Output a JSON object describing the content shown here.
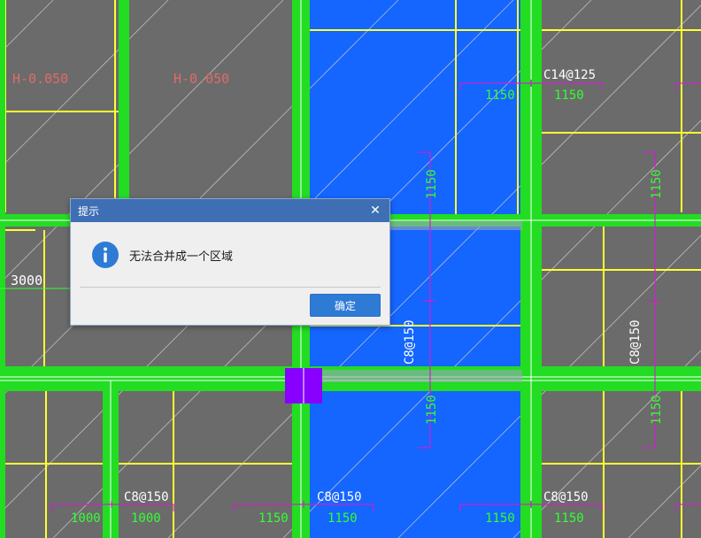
{
  "canvas": {
    "labels": {
      "elev_left": "H-0.050",
      "elev_mid": "H-0.050",
      "dim_3000": "3000",
      "c14_top": "C14@125",
      "dim_1150_top_a": "1150",
      "dim_1150_top_b": "1150",
      "dim_1150_v_top_mid": "1150",
      "dim_1150_v_top_right": "1150",
      "c8_v_mid": "C8@150",
      "c8_v_right": "C8@150",
      "dim_1150_v_bot_mid": "1150",
      "dim_1150_v_bot_right": "1150",
      "c8_bot_left": "C8@150",
      "c8_bot_mid": "C8@150",
      "c8_bot_right": "C8@150",
      "dim_1000_a": "1000",
      "dim_1000_b": "1000",
      "dim_1150_bot_a": "1150",
      "dim_1150_bot_b": "1150",
      "dim_1150_bot_c": "1150",
      "dim_1150_bot_d": "1150"
    },
    "colors": {
      "background": "#6b6b6b",
      "slab_fill": "#1565ff",
      "beam_green": "#22dd22",
      "grid_yellow": "#ffff33",
      "dim_magenta": "#cc22cc",
      "elev_red": "#e06a6a",
      "dim_green_text": "#33ff33",
      "column_purple": "#8800ff"
    }
  },
  "dialog": {
    "title": "提示",
    "message": "无法合并成一个区域",
    "ok_label": "确定",
    "icon": "info-icon"
  }
}
